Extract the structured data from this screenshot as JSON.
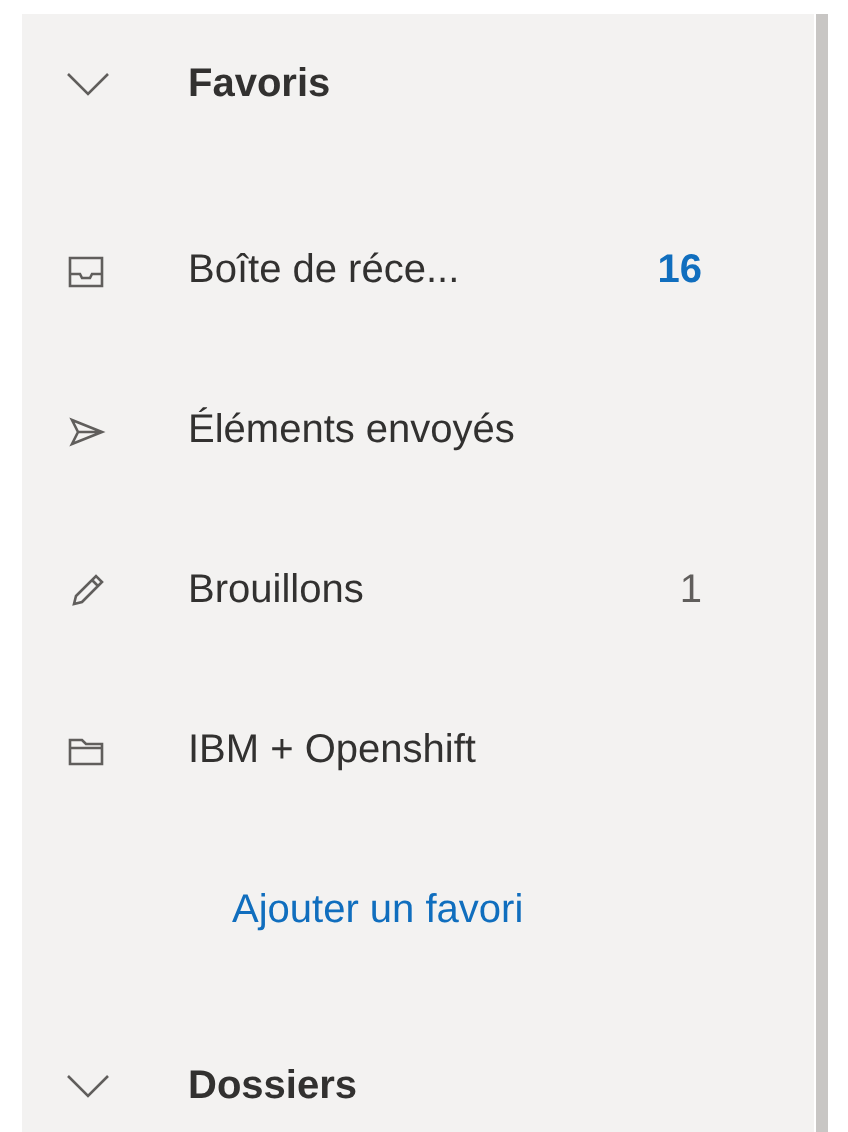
{
  "sections": [
    {
      "title": "Favoris",
      "expanded": true,
      "items": [
        {
          "kind": "inbox",
          "label": "Boîte de réce...",
          "count": "16",
          "unread": true
        },
        {
          "kind": "sent",
          "label": "Éléments envoyés"
        },
        {
          "kind": "drafts",
          "label": "Brouillons",
          "count": "1",
          "unread": false
        },
        {
          "kind": "folder",
          "label": "IBM + Openshift"
        }
      ],
      "add_link": "Ajouter un favori"
    },
    {
      "title": "Dossiers",
      "expanded": true
    }
  ]
}
